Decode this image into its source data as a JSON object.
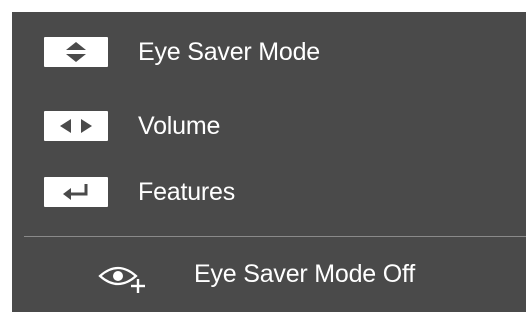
{
  "menu": {
    "items": [
      {
        "icon": "up-down-arrows-icon",
        "label": "Eye Saver Mode"
      },
      {
        "icon": "left-right-arrows-icon",
        "label": "Volume"
      },
      {
        "icon": "enter-return-icon",
        "label": "Features"
      }
    ]
  },
  "footer": {
    "icon": "eye-plus-icon",
    "status": "Eye Saver Mode Off"
  },
  "colors": {
    "panel": "#4a4a4a",
    "text": "#ffffff",
    "key_bg": "#ffffff",
    "glyph": "#4a4a4a"
  }
}
